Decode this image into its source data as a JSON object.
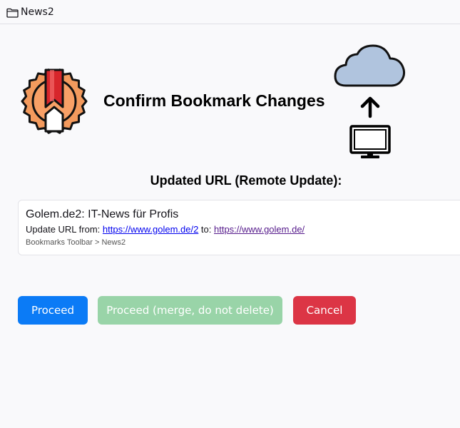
{
  "topbar": {
    "folder_label": "News2",
    "icon": "folder-icon"
  },
  "header": {
    "title": "Confirm Bookmark Changes",
    "logo_icon": "bookmark-badge-logo",
    "cloud_icon": "cloud-icon",
    "arrow_icon": "arrow-up-icon",
    "monitor_icon": "monitor-icon"
  },
  "section": {
    "heading": "Updated URL (Remote Update):"
  },
  "bookmark": {
    "title": "Golem.de2: IT-News für Profis",
    "update_prefix": "Update URL from: ",
    "old_url": "https://www.golem.de/2",
    "update_middle": " to: ",
    "new_url": "https://www.golem.de/",
    "path": "Bookmarks Toolbar > News2"
  },
  "buttons": {
    "proceed": "Proceed",
    "merge": "Proceed (merge, do not delete)",
    "cancel": "Cancel"
  },
  "colors": {
    "proceed": "#0b7bf6",
    "merge": "#99d4a8",
    "cancel": "#dc3545",
    "cloud_fill": "#b0c4de",
    "logo_orange": "#f39a5d",
    "logo_red": "#d7262b"
  }
}
